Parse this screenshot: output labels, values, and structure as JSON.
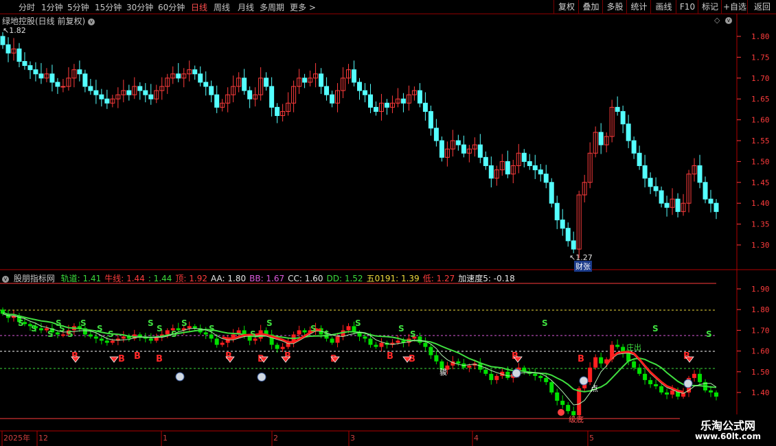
{
  "toolbar": {
    "periods": [
      "分时",
      "1分钟",
      "5分钟",
      "15分钟",
      "30分钟",
      "60分钟",
      "日线",
      "周线",
      "月线",
      "多周期",
      "更多 >"
    ],
    "active_period": "日线",
    "buttons": [
      "复权",
      "叠加",
      "多股",
      "统计",
      "画线",
      "F10",
      "标记",
      "+自选",
      "返回"
    ]
  },
  "main_panel": {
    "title": "绿地控股(日线 前复权)",
    "high_marker": "1.82",
    "low_marker": "1.27",
    "event_tag": "财张",
    "price_ticks": [
      "1.80",
      "1.75",
      "1.70",
      "1.65",
      "1.60",
      "1.55",
      "1.50",
      "1.45",
      "1.40",
      "1.35",
      "1.30"
    ]
  },
  "indicator_panel": {
    "name": "股朋指标网",
    "items": [
      {
        "label": "轨道:",
        "value": "1.41",
        "color": "#3cdc3c"
      },
      {
        "label": "牛线:",
        "value": "1.44",
        "color": "#ff3c3c"
      },
      {
        "label": ":",
        "value": "1.44",
        "color": "#3cdc3c"
      },
      {
        "label": "顶:",
        "value": "1.92",
        "color": "#ff3c3c"
      },
      {
        "label": "AA:",
        "value": "1.80",
        "color": "#e6e6e6"
      },
      {
        "label": "BB:",
        "value": "1.67",
        "color": "#dc5adc"
      },
      {
        "label": "CC:",
        "value": "1.60",
        "color": "#e6e6e6"
      },
      {
        "label": "DD:",
        "value": "1.52",
        "color": "#3cdc3c"
      },
      {
        "label": "五0191:",
        "value": "1.39",
        "color": "#f0dc3c"
      },
      {
        "label": "低:",
        "value": "1.27",
        "color": "#ff3c3c"
      },
      {
        "label": "加速度5:",
        "value": "-0.18",
        "color": "#e6e6e6"
      }
    ],
    "price_ticks": [
      "1.90",
      "1.80",
      "1.70",
      "1.60",
      "1.50",
      "1.40"
    ],
    "annotations": {
      "zhuangchu": "庄出",
      "dian": "点",
      "dibu": "级底",
      "jun": "骏"
    }
  },
  "date_axis": [
    {
      "label": "2025年",
      "x": 5
    },
    {
      "label": "12",
      "x": 56
    },
    {
      "label": "1",
      "x": 237
    },
    {
      "label": "2",
      "x": 398
    },
    {
      "label": "3",
      "x": 510
    },
    {
      "label": "4",
      "x": 690
    },
    {
      "label": "5",
      "x": 858
    }
  ],
  "watermark": {
    "line1": "乐淘公式网",
    "line2": "www.60lt.com"
  },
  "colors": {
    "up": "#ff3c3c",
    "down": "#54ffff",
    "ind_up": "#ff2020",
    "ind_down": "#00e000",
    "axis": "#ff3c3c",
    "grid": "#7a0000"
  },
  "chart_data": {
    "type": "candlestick",
    "series_close": [
      1.78,
      1.76,
      1.77,
      1.74,
      1.73,
      1.72,
      1.71,
      1.7,
      1.71,
      1.69,
      1.68,
      1.68,
      1.7,
      1.72,
      1.71,
      1.68,
      1.67,
      1.66,
      1.65,
      1.64,
      1.65,
      1.66,
      1.67,
      1.66,
      1.68,
      1.67,
      1.66,
      1.65,
      1.67,
      1.68,
      1.7,
      1.71,
      1.7,
      1.71,
      1.72,
      1.71,
      1.69,
      1.68,
      1.66,
      1.63,
      1.64,
      1.66,
      1.68,
      1.7,
      1.67,
      1.65,
      1.66,
      1.7,
      1.68,
      1.63,
      1.61,
      1.62,
      1.64,
      1.68,
      1.7,
      1.69,
      1.7,
      1.71,
      1.68,
      1.66,
      1.64,
      1.67,
      1.7,
      1.72,
      1.69,
      1.67,
      1.66,
      1.63,
      1.62,
      1.64,
      1.63,
      1.64,
      1.65,
      1.64,
      1.66,
      1.67,
      1.64,
      1.62,
      1.58,
      1.55,
      1.51,
      1.53,
      1.55,
      1.54,
      1.52,
      1.53,
      1.54,
      1.51,
      1.49,
      1.46,
      1.48,
      1.5,
      1.47,
      1.49,
      1.52,
      1.5,
      1.49,
      1.48,
      1.47,
      1.45,
      1.4,
      1.36,
      1.34,
      1.31,
      1.29,
      1.42,
      1.45,
      1.52,
      1.57,
      1.54,
      1.56,
      1.63,
      1.62,
      1.59,
      1.55,
      1.52,
      1.49,
      1.46,
      1.44,
      1.43,
      1.4,
      1.39,
      1.41,
      1.38,
      1.4,
      1.47,
      1.49,
      1.45,
      1.41,
      1.4,
      1.38
    ],
    "high": 1.82,
    "low": 1.27,
    "ylim": [
      1.27,
      1.84
    ]
  }
}
